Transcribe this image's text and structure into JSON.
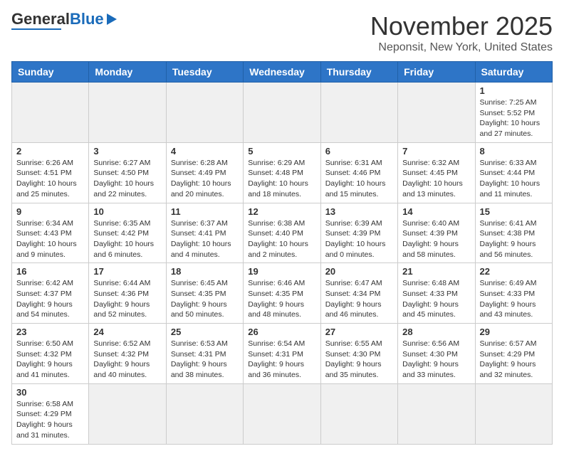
{
  "header": {
    "logo_general": "General",
    "logo_blue": "Blue",
    "month": "November 2025",
    "location": "Neponsit, New York, United States"
  },
  "weekdays": [
    "Sunday",
    "Monday",
    "Tuesday",
    "Wednesday",
    "Thursday",
    "Friday",
    "Saturday"
  ],
  "weeks": [
    [
      {
        "day": "",
        "info": ""
      },
      {
        "day": "",
        "info": ""
      },
      {
        "day": "",
        "info": ""
      },
      {
        "day": "",
        "info": ""
      },
      {
        "day": "",
        "info": ""
      },
      {
        "day": "",
        "info": ""
      },
      {
        "day": "1",
        "info": "Sunrise: 7:25 AM\nSunset: 5:52 PM\nDaylight: 10 hours and 27 minutes."
      }
    ],
    [
      {
        "day": "2",
        "info": "Sunrise: 6:26 AM\nSunset: 4:51 PM\nDaylight: 10 hours and 25 minutes."
      },
      {
        "day": "3",
        "info": "Sunrise: 6:27 AM\nSunset: 4:50 PM\nDaylight: 10 hours and 22 minutes."
      },
      {
        "day": "4",
        "info": "Sunrise: 6:28 AM\nSunset: 4:49 PM\nDaylight: 10 hours and 20 minutes."
      },
      {
        "day": "5",
        "info": "Sunrise: 6:29 AM\nSunset: 4:48 PM\nDaylight: 10 hours and 18 minutes."
      },
      {
        "day": "6",
        "info": "Sunrise: 6:31 AM\nSunset: 4:46 PM\nDaylight: 10 hours and 15 minutes."
      },
      {
        "day": "7",
        "info": "Sunrise: 6:32 AM\nSunset: 4:45 PM\nDaylight: 10 hours and 13 minutes."
      },
      {
        "day": "8",
        "info": "Sunrise: 6:33 AM\nSunset: 4:44 PM\nDaylight: 10 hours and 11 minutes."
      }
    ],
    [
      {
        "day": "9",
        "info": "Sunrise: 6:34 AM\nSunset: 4:43 PM\nDaylight: 10 hours and 9 minutes."
      },
      {
        "day": "10",
        "info": "Sunrise: 6:35 AM\nSunset: 4:42 PM\nDaylight: 10 hours and 6 minutes."
      },
      {
        "day": "11",
        "info": "Sunrise: 6:37 AM\nSunset: 4:41 PM\nDaylight: 10 hours and 4 minutes."
      },
      {
        "day": "12",
        "info": "Sunrise: 6:38 AM\nSunset: 4:40 PM\nDaylight: 10 hours and 2 minutes."
      },
      {
        "day": "13",
        "info": "Sunrise: 6:39 AM\nSunset: 4:39 PM\nDaylight: 10 hours and 0 minutes."
      },
      {
        "day": "14",
        "info": "Sunrise: 6:40 AM\nSunset: 4:39 PM\nDaylight: 9 hours and 58 minutes."
      },
      {
        "day": "15",
        "info": "Sunrise: 6:41 AM\nSunset: 4:38 PM\nDaylight: 9 hours and 56 minutes."
      }
    ],
    [
      {
        "day": "16",
        "info": "Sunrise: 6:42 AM\nSunset: 4:37 PM\nDaylight: 9 hours and 54 minutes."
      },
      {
        "day": "17",
        "info": "Sunrise: 6:44 AM\nSunset: 4:36 PM\nDaylight: 9 hours and 52 minutes."
      },
      {
        "day": "18",
        "info": "Sunrise: 6:45 AM\nSunset: 4:35 PM\nDaylight: 9 hours and 50 minutes."
      },
      {
        "day": "19",
        "info": "Sunrise: 6:46 AM\nSunset: 4:35 PM\nDaylight: 9 hours and 48 minutes."
      },
      {
        "day": "20",
        "info": "Sunrise: 6:47 AM\nSunset: 4:34 PM\nDaylight: 9 hours and 46 minutes."
      },
      {
        "day": "21",
        "info": "Sunrise: 6:48 AM\nSunset: 4:33 PM\nDaylight: 9 hours and 45 minutes."
      },
      {
        "day": "22",
        "info": "Sunrise: 6:49 AM\nSunset: 4:33 PM\nDaylight: 9 hours and 43 minutes."
      }
    ],
    [
      {
        "day": "23",
        "info": "Sunrise: 6:50 AM\nSunset: 4:32 PM\nDaylight: 9 hours and 41 minutes."
      },
      {
        "day": "24",
        "info": "Sunrise: 6:52 AM\nSunset: 4:32 PM\nDaylight: 9 hours and 40 minutes."
      },
      {
        "day": "25",
        "info": "Sunrise: 6:53 AM\nSunset: 4:31 PM\nDaylight: 9 hours and 38 minutes."
      },
      {
        "day": "26",
        "info": "Sunrise: 6:54 AM\nSunset: 4:31 PM\nDaylight: 9 hours and 36 minutes."
      },
      {
        "day": "27",
        "info": "Sunrise: 6:55 AM\nSunset: 4:30 PM\nDaylight: 9 hours and 35 minutes."
      },
      {
        "day": "28",
        "info": "Sunrise: 6:56 AM\nSunset: 4:30 PM\nDaylight: 9 hours and 33 minutes."
      },
      {
        "day": "29",
        "info": "Sunrise: 6:57 AM\nSunset: 4:29 PM\nDaylight: 9 hours and 32 minutes."
      }
    ],
    [
      {
        "day": "30",
        "info": "Sunrise: 6:58 AM\nSunset: 4:29 PM\nDaylight: 9 hours and 31 minutes."
      },
      {
        "day": "",
        "info": ""
      },
      {
        "day": "",
        "info": ""
      },
      {
        "day": "",
        "info": ""
      },
      {
        "day": "",
        "info": ""
      },
      {
        "day": "",
        "info": ""
      },
      {
        "day": "",
        "info": ""
      }
    ]
  ]
}
